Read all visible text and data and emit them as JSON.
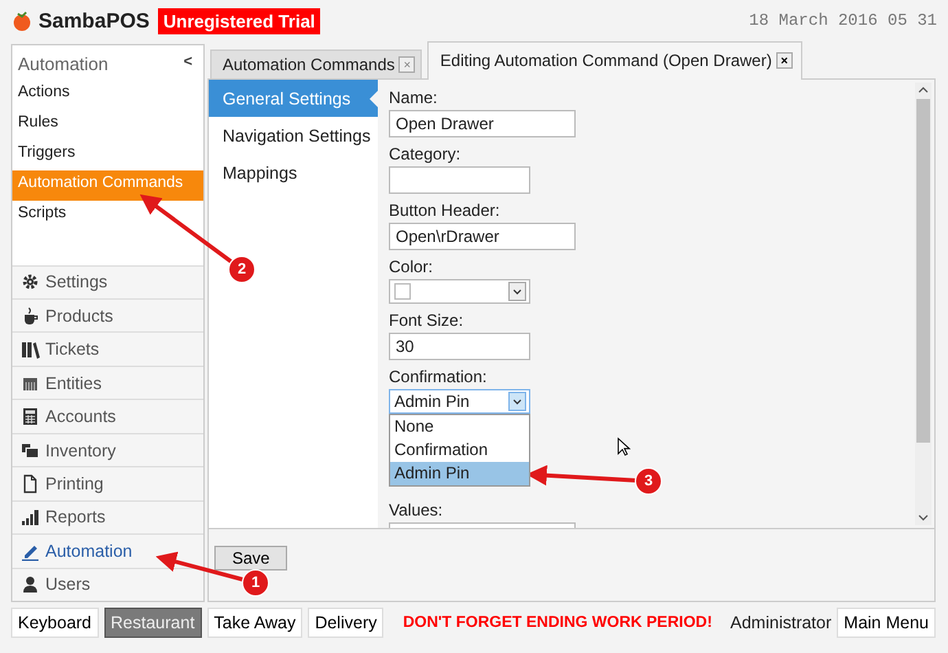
{
  "header": {
    "app_name": "SambaPOS",
    "badge": "Unregistered Trial",
    "datetime": "18 March 2016 05 31"
  },
  "sidebar": {
    "title": "Automation",
    "collapse": "<",
    "items": [
      {
        "label": "Actions",
        "selected": false
      },
      {
        "label": "Rules",
        "selected": false
      },
      {
        "label": "Triggers",
        "selected": false
      },
      {
        "label": "Automation Commands",
        "selected": true
      },
      {
        "label": "Scripts",
        "selected": false
      }
    ],
    "modules": [
      {
        "label": "Settings",
        "selected": false
      },
      {
        "label": "Products",
        "selected": false
      },
      {
        "label": "Tickets",
        "selected": false
      },
      {
        "label": "Entities",
        "selected": false
      },
      {
        "label": "Accounts",
        "selected": false
      },
      {
        "label": "Inventory",
        "selected": false
      },
      {
        "label": "Printing",
        "selected": false
      },
      {
        "label": "Reports",
        "selected": false
      },
      {
        "label": "Automation",
        "selected": true
      },
      {
        "label": "Users",
        "selected": false
      }
    ]
  },
  "tabs": [
    {
      "label": "Automation Commands",
      "close": "×",
      "selected": false
    },
    {
      "label": "Editing Automation Command (Open Drawer)",
      "close": "×",
      "selected": true
    }
  ],
  "nav": [
    {
      "label": "General Settings",
      "selected": true
    },
    {
      "label": "Navigation Settings",
      "selected": false
    },
    {
      "label": "Mappings",
      "selected": false
    }
  ],
  "form": [
    {
      "label": "Name:",
      "kind": "text",
      "value": "Open Drawer"
    },
    {
      "label": "Category:",
      "kind": "text"
    },
    {
      "label": "Button Header:",
      "kind": "text",
      "value": "Open\\rDrawer"
    },
    {
      "label": "Color:",
      "kind": "color",
      "color": "#ffffff"
    },
    {
      "label": "Font Size:",
      "kind": "text",
      "value": "30"
    },
    {
      "label": "Confirmation:",
      "kind": "combo",
      "value": "Admin Pin",
      "expanded": true,
      "options": [
        {
          "label": "None",
          "selected": false
        },
        {
          "label": "Confirmation",
          "selected": false
        },
        {
          "label": "Admin Pin",
          "selected": true
        }
      ]
    },
    {
      "label": "Values:",
      "kind": "text"
    }
  ],
  "save_button": "Save",
  "footer": {
    "buttons": [
      {
        "label": "Keyboard",
        "selected": false
      },
      {
        "label": "Restaurant",
        "selected": true
      },
      {
        "label": "Take Away",
        "selected": false
      },
      {
        "label": "Delivery",
        "selected": false
      }
    ],
    "warning": "DON'T FORGET ENDING WORK PERIOD!",
    "user": "Administrator",
    "main_menu": "Main Menu"
  },
  "annotations": [
    {
      "label": "1"
    },
    {
      "label": "2"
    },
    {
      "label": "3"
    }
  ]
}
